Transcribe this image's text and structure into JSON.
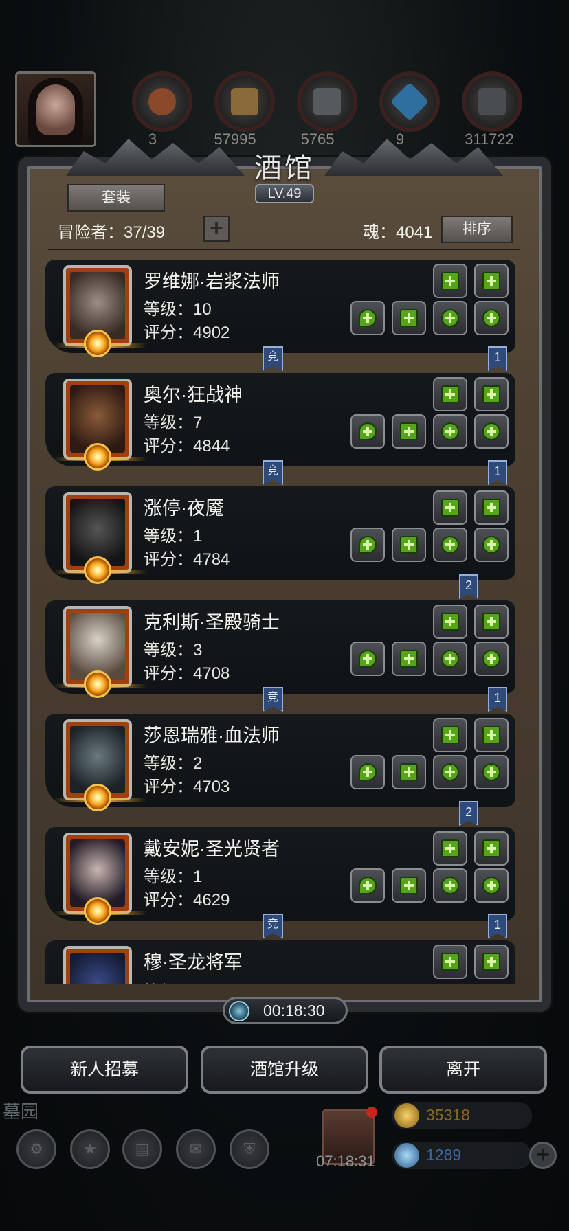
{
  "top_bar": {
    "resources": [
      {
        "name": "meat-resource",
        "value": "3"
      },
      {
        "name": "wood-resource",
        "value": "57995"
      },
      {
        "name": "iron-resource",
        "value": "5765"
      },
      {
        "name": "crystal-resource",
        "value": "9"
      },
      {
        "name": "ore-resource",
        "value": "311722"
      }
    ]
  },
  "tavern": {
    "title": "酒馆",
    "level": "LV.49",
    "suit_button": "套装",
    "adventurers_label": "冒险者：37/39",
    "add_button": "+",
    "soul_label": "魂：4041",
    "sort_button": "排序"
  },
  "heroes": [
    {
      "name": "罗维娜·岩浆法师",
      "level": "等级：10",
      "score": "评分：4902",
      "tag": "竞",
      "tag2": "1"
    },
    {
      "name": "奥尔·狂战神",
      "level": "等级：7",
      "score": "评分：4844",
      "tag": "竞",
      "tag2": "1"
    },
    {
      "name": "涨停·夜魇",
      "level": "等级：1",
      "score": "评分：4784",
      "tag": "",
      "tag2": "2"
    },
    {
      "name": "克利斯·圣殿骑士",
      "level": "等级：3",
      "score": "评分：4708",
      "tag": "竞",
      "tag2": "1"
    },
    {
      "name": "莎恩瑞雅·血法师",
      "level": "等级：2",
      "score": "评分：4703",
      "tag": "",
      "tag2": "2"
    },
    {
      "name": "戴安妮·圣光贤者",
      "level": "等级：1",
      "score": "评分：4629",
      "tag": "竞",
      "tag2": "1"
    },
    {
      "name": "穆·圣龙将军",
      "level": "等级",
      "score": "",
      "tag": "",
      "tag2": ""
    }
  ],
  "timer": "00:18:30",
  "actions": {
    "recruit": "新人招募",
    "upgrade": "酒馆升级",
    "leave": "离开"
  },
  "background": {
    "location": "墓园",
    "gift_timer": "07:18:31",
    "gold": "35318",
    "gems": "1289"
  },
  "colors": {
    "accent_green": "#56a31e",
    "tag_blue": "#2f4a7a",
    "frame_brown": "#4c4032"
  }
}
